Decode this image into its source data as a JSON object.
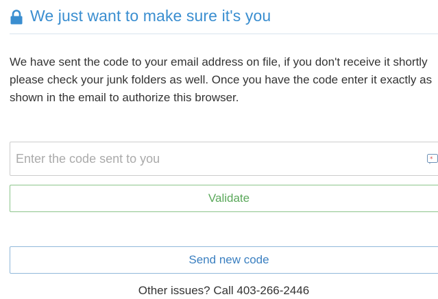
{
  "header": {
    "title": "We just want to make sure it's you",
    "icon": "lock-icon",
    "accent_color": "#3a8ed0"
  },
  "message": {
    "text": "We have sent the code to your email address on file, if you don't receive it shortly please check your junk folders as well. Once you have the code enter it exactly as shown in the email to authorize this browser."
  },
  "code_input": {
    "placeholder": "Enter the code sent to you",
    "value": "",
    "trailing_icon": "keypad-icon"
  },
  "buttons": {
    "validate_label": "Validate",
    "validate_color": "#5aa85a",
    "send_new_code_label": "Send new code",
    "send_new_code_color": "#3a7fc0"
  },
  "footer": {
    "other_issues": "Other issues? Call 403-266-2446"
  }
}
